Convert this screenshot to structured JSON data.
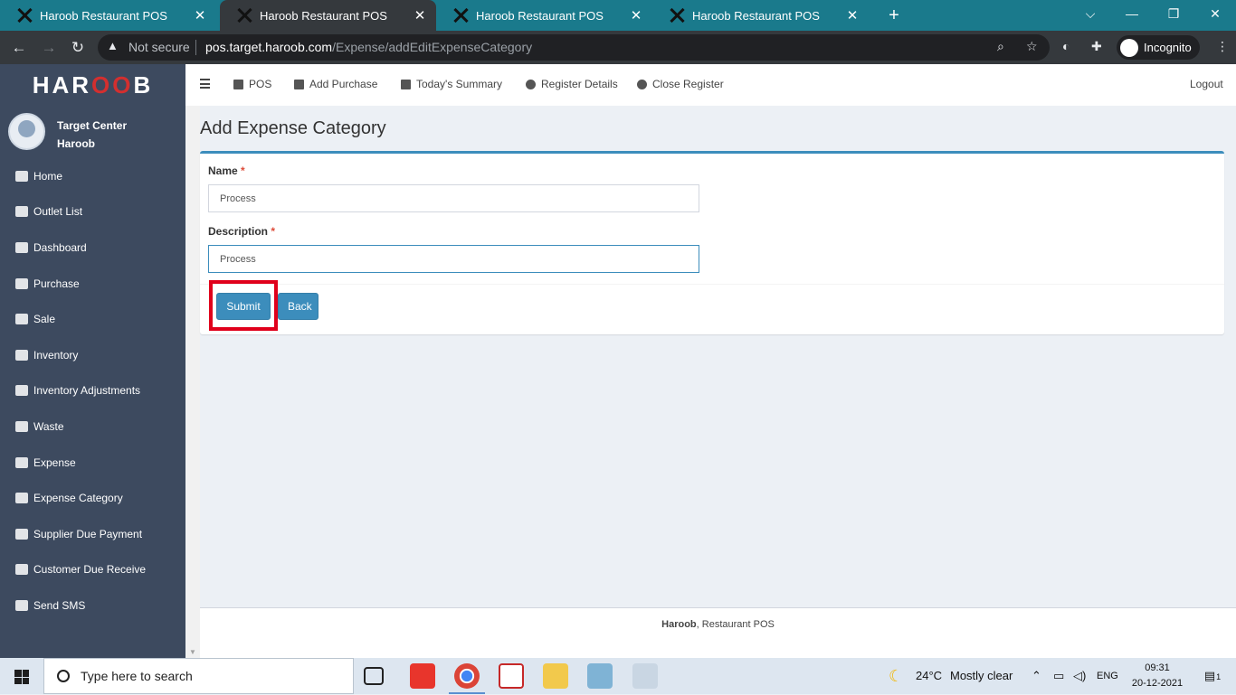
{
  "browser": {
    "tabs": [
      {
        "title": "Haroob Restaurant POS",
        "active": false
      },
      {
        "title": "Haroob Restaurant POS",
        "active": true
      },
      {
        "title": "Haroob Restaurant POS",
        "active": false
      },
      {
        "title": "Haroob Restaurant POS",
        "active": false
      }
    ],
    "not_secure": "Not secure",
    "url_host": "pos.target.haroob.com",
    "url_path": "/Expense/addEditExpenseCategory",
    "incognito_label": "Incognito"
  },
  "sidebar": {
    "logo_a": "HAR",
    "logo_b": "OO",
    "logo_c": "B",
    "user_line1": "Target Center",
    "user_line2": "Haroob",
    "items": [
      {
        "label": "Home",
        "icon": "home-icon"
      },
      {
        "label": "Outlet List",
        "icon": "list-icon"
      },
      {
        "label": "Dashboard",
        "icon": "dashboard-icon"
      },
      {
        "label": "Purchase",
        "icon": "truck-icon"
      },
      {
        "label": "Sale",
        "icon": "cutlery-icon"
      },
      {
        "label": "Inventory",
        "icon": "inbox-icon"
      },
      {
        "label": "Inventory Adjustments",
        "icon": "adjust-icon"
      },
      {
        "label": "Waste",
        "icon": "trash-icon"
      },
      {
        "label": "Expense",
        "icon": "money-icon"
      },
      {
        "label": "Expense Category",
        "icon": "category-list-icon"
      },
      {
        "label": "Supplier Due Payment",
        "icon": "money-icon"
      },
      {
        "label": "Customer Due Receive",
        "icon": "money-icon"
      },
      {
        "label": "Send SMS",
        "icon": "sms-icon"
      }
    ]
  },
  "topnav": {
    "pos": "POS",
    "add_purchase": "Add Purchase",
    "todays_summary": "Today's Summary",
    "register_details": "Register Details",
    "close_register": "Close Register",
    "logout": "Logout"
  },
  "form": {
    "page_title": "Add Expense Category",
    "name_label": "Name",
    "name_value": "Process",
    "description_label": "Description",
    "description_value": "Process",
    "required_mark": "*",
    "submit_label": "Submit",
    "back_label": "Back"
  },
  "footer": {
    "brand": "Haroob",
    "text": ", Restaurant POS"
  },
  "taskbar": {
    "search_placeholder": "Type here to search",
    "weather_temp": "24°C",
    "weather_text": "Mostly clear",
    "lang": "ENG",
    "time": "09:31",
    "date": "20-12-2021",
    "notification_count": "1"
  },
  "colors": {
    "primary": "#3c8dbc",
    "sidebar_bg": "#3d4a5f",
    "highlight": "#e0001b"
  }
}
